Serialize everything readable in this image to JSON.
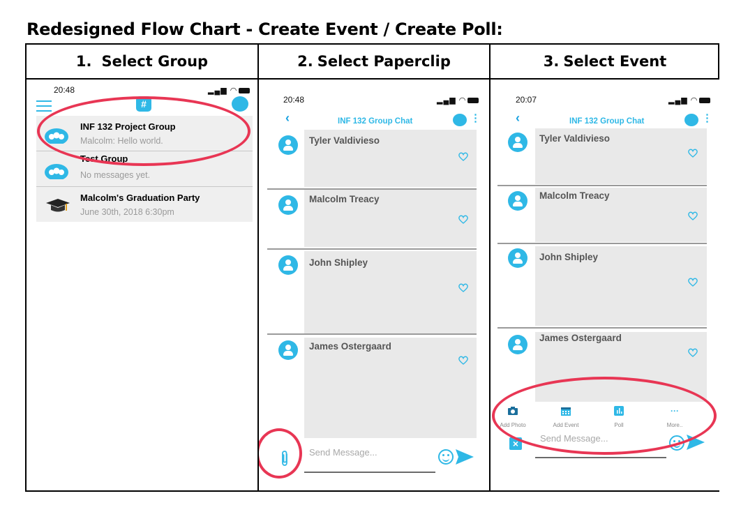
{
  "document": {
    "title": "Redesigned Flow Chart - Create Event / Create Poll:"
  },
  "steps": [
    {
      "number": "1.",
      "label": "Select Group"
    },
    {
      "number": "2.",
      "label": "Select Paperclip"
    },
    {
      "number": "3.",
      "label": "Select Event"
    }
  ],
  "screen1": {
    "time": "20:48",
    "groups": [
      {
        "name": "INF 132 Project Group",
        "subtitle": "Malcolm: Hello world."
      },
      {
        "name": "Test Group",
        "subtitle": "No messages yet."
      },
      {
        "name": "Malcolm's Graduation Party",
        "subtitle": "June 30th, 2018 6:30pm"
      }
    ]
  },
  "screen2": {
    "time": "20:48",
    "chat_title": "INF 132 Group Chat",
    "messages": [
      "Tyler Valdivieso",
      "Malcolm Treacy",
      "John Shipley",
      "James Ostergaard"
    ],
    "compose_placeholder": "Send Message..."
  },
  "screen3": {
    "time": "20:07",
    "chat_title": "INF 132 Group Chat",
    "messages": [
      "Tyler Valdivieso",
      "Malcolm Treacy",
      "John Shipley",
      "James Ostergaard"
    ],
    "actions": [
      {
        "label": "Add Photo",
        "icon": "add-photo-icon"
      },
      {
        "label": "Add Event",
        "icon": "calendar-icon"
      },
      {
        "label": "Poll",
        "icon": "poll-icon"
      },
      {
        "label": "More..",
        "icon": "more-icon"
      }
    ],
    "compose_placeholder": "Send Message..."
  },
  "colors": {
    "accent": "#2fb8e6",
    "highlight": "#e83654",
    "bubble": "#e9e9e9"
  }
}
